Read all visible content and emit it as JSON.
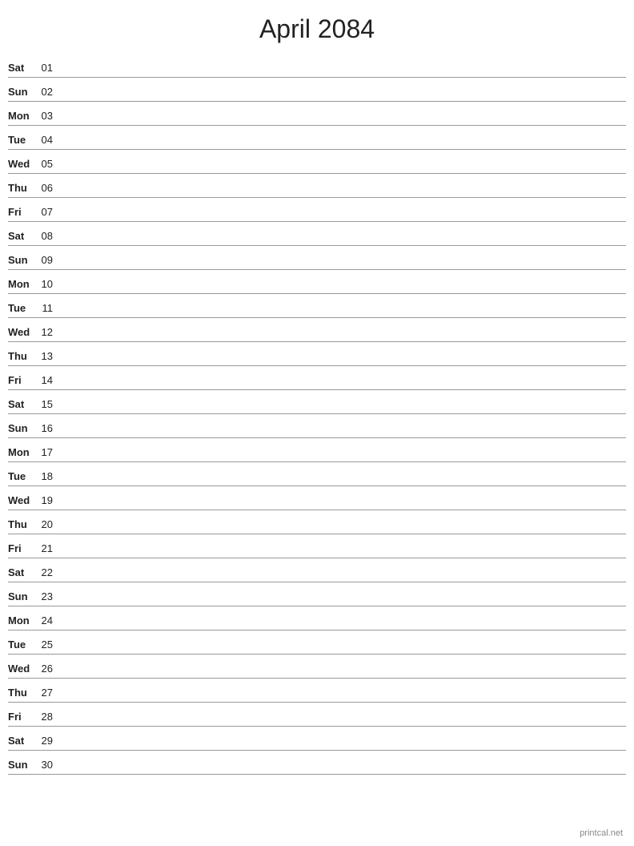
{
  "header": {
    "title": "April 2084"
  },
  "days": [
    {
      "name": "Sat",
      "num": "01"
    },
    {
      "name": "Sun",
      "num": "02"
    },
    {
      "name": "Mon",
      "num": "03"
    },
    {
      "name": "Tue",
      "num": "04"
    },
    {
      "name": "Wed",
      "num": "05"
    },
    {
      "name": "Thu",
      "num": "06"
    },
    {
      "name": "Fri",
      "num": "07"
    },
    {
      "name": "Sat",
      "num": "08"
    },
    {
      "name": "Sun",
      "num": "09"
    },
    {
      "name": "Mon",
      "num": "10"
    },
    {
      "name": "Tue",
      "num": "11"
    },
    {
      "name": "Wed",
      "num": "12"
    },
    {
      "name": "Thu",
      "num": "13"
    },
    {
      "name": "Fri",
      "num": "14"
    },
    {
      "name": "Sat",
      "num": "15"
    },
    {
      "name": "Sun",
      "num": "16"
    },
    {
      "name": "Mon",
      "num": "17"
    },
    {
      "name": "Tue",
      "num": "18"
    },
    {
      "name": "Wed",
      "num": "19"
    },
    {
      "name": "Thu",
      "num": "20"
    },
    {
      "name": "Fri",
      "num": "21"
    },
    {
      "name": "Sat",
      "num": "22"
    },
    {
      "name": "Sun",
      "num": "23"
    },
    {
      "name": "Mon",
      "num": "24"
    },
    {
      "name": "Tue",
      "num": "25"
    },
    {
      "name": "Wed",
      "num": "26"
    },
    {
      "name": "Thu",
      "num": "27"
    },
    {
      "name": "Fri",
      "num": "28"
    },
    {
      "name": "Sat",
      "num": "29"
    },
    {
      "name": "Sun",
      "num": "30"
    }
  ],
  "footer": {
    "text": "printcal.net"
  }
}
